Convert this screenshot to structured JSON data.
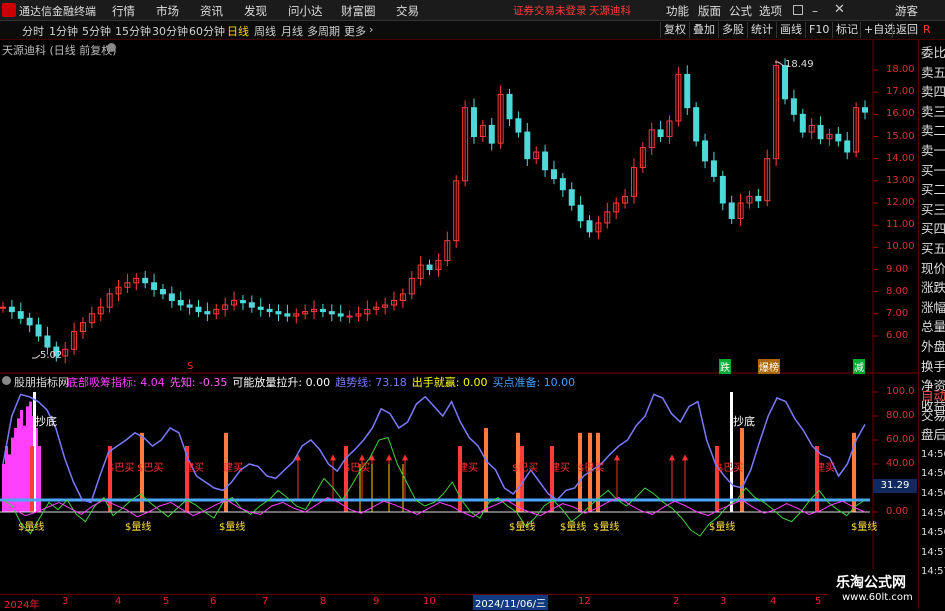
{
  "app": {
    "name": "通达信金融终端"
  },
  "menu": [
    "行情",
    "市场",
    "资讯",
    "发现",
    "问小达",
    "财富圈",
    "交易"
  ],
  "notice": {
    "account": "证券交易未登录",
    "stock": "天源迪科"
  },
  "right_menu": [
    "功能",
    "版面",
    "公式",
    "选项"
  ],
  "guest": "游客",
  "toolbar": {
    "periods": [
      "分时",
      "1分钟",
      "5分钟",
      "15分钟",
      "30分钟",
      "60分钟",
      "日线",
      "周线",
      "月线",
      "多周期",
      "更多"
    ],
    "active": "日线",
    "right_buttons": [
      "复权",
      "叠加",
      "多股",
      "统计",
      "画线",
      "F10",
      "标记",
      "+自选",
      "返回"
    ]
  },
  "chart_header": {
    "title": "天源迪科 (日线 前复权)"
  },
  "right_panel": {
    "items": [
      "委比",
      "卖五",
      "卖四",
      "卖三",
      "卖二",
      "卖一",
      "买一",
      "买二",
      "买三",
      "买四",
      "买五",
      "现价",
      "涨跌",
      "涨幅",
      "总量",
      "外盘",
      "换手",
      "净资",
      "收益"
    ],
    "sub_items": [
      "自动",
      "交易",
      "盘后",
      "14:56",
      "14:56",
      "14:56",
      "14:56",
      "14:56",
      "14:57",
      "14:57"
    ]
  },
  "price_axis": [
    "18.00",
    "17.00",
    "16.00",
    "15.00",
    "14.00",
    "13.00",
    "12.00",
    "11.00",
    "10.00",
    "9.00",
    "8.00",
    "7.00",
    "6.00"
  ],
  "indicator_axis": [
    "100.0",
    "80.00",
    "60.00",
    "40.00",
    "20.00",
    "0.00"
  ],
  "indicator_current": "31.29",
  "annotations": {
    "high": "18.49",
    "low": "5.02"
  },
  "top_markers": {
    "s": "S",
    "die": "跌",
    "baoliang": "爆榜",
    "jian": "减"
  },
  "indicator_header": {
    "name": "股朋指标网",
    "items": [
      {
        "label": "底部吸筹指标:",
        "value": "4.04",
        "color": "#ff40ff"
      },
      {
        "label": "先知:",
        "value": "-0.35",
        "color": "#ff60ff"
      },
      {
        "label": "可能放量拉升:",
        "value": "0.00",
        "color": "#ffffff"
      },
      {
        "label": "趋势线:",
        "value": "73.18",
        "color": "#7a7aff"
      },
      {
        "label": "出手就赢:",
        "value": "0.00",
        "color": "#ffff00"
      },
      {
        "label": "买点准备:",
        "value": "10.00",
        "color": "#40a0ff"
      }
    ]
  },
  "sub_labels": {
    "chaodi": "抄底",
    "maixian": "$量线",
    "bamai": "$巴买",
    "jianmai": "建买"
  },
  "date_axis": {
    "year": "2024年",
    "labels": [
      "3",
      "4",
      "5",
      "6",
      "7",
      "8",
      "9",
      "10",
      "2024/11/06/三",
      "12",
      "2",
      "3",
      "4",
      "5"
    ]
  },
  "watermark": {
    "line1": "乐淘公式网",
    "line2": "www.60lt.com"
  },
  "chart_data": {
    "type": "candlestick",
    "title": "天源迪科 (日线 前复权)",
    "y_price_range": [
      5,
      18.5
    ],
    "max_annotation": 18.49,
    "min_annotation": 5.02,
    "close_series": [
      7.3,
      7.1,
      6.8,
      6.5,
      6.0,
      5.5,
      5.1,
      5.4,
      6.2,
      6.6,
      7.0,
      7.3,
      7.9,
      8.2,
      8.4,
      8.6,
      8.4,
      8.1,
      7.9,
      7.6,
      7.4,
      7.3,
      7.1,
      7.0,
      7.2,
      7.4,
      7.6,
      7.5,
      7.3,
      7.2,
      7.1,
      7.0,
      6.9,
      7.0,
      7.1,
      7.2,
      7.1,
      7.0,
      6.9,
      6.9,
      7.0,
      7.2,
      7.3,
      7.4,
      7.6,
      7.9,
      8.6,
      9.2,
      9.0,
      9.4,
      10.3,
      13.0,
      16.3,
      15.0,
      15.5,
      14.7,
      16.9,
      15.8,
      15.2,
      14.0,
      14.3,
      13.5,
      13.1,
      12.6,
      11.9,
      11.2,
      10.7,
      11.1,
      11.6,
      12.0,
      12.3,
      13.6,
      14.5,
      15.3,
      15.0,
      15.7,
      17.8,
      16.3,
      14.8,
      13.9,
      13.2,
      12.0,
      11.3,
      12.0,
      12.3,
      12.1,
      14.0,
      18.2,
      16.7,
      16.0,
      15.2,
      15.5,
      14.9,
      15.1,
      14.8,
      14.3,
      16.3,
      16.1
    ],
    "indicator": {
      "y_range": [
        0,
        100
      ],
      "trend_line_last": 73.18,
      "buy_prepare_level": 10.0,
      "current_value": 31.29
    }
  }
}
